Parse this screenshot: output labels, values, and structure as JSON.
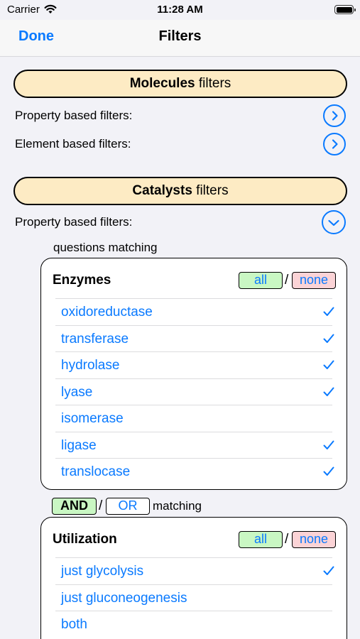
{
  "status": {
    "carrier": "Carrier",
    "time": "11:28 AM"
  },
  "nav": {
    "done_label": "Done",
    "title": "Filters"
  },
  "molecules": {
    "header_bold": "Molecules",
    "header_rest": " filters",
    "property_label": "Property based filters:",
    "element_label": "Element based filters:"
  },
  "catalysts": {
    "header_bold": "Catalysts",
    "header_rest": " filters",
    "property_label": "Property based filters:",
    "questions_matching": "questions matching",
    "enzymes": {
      "title": "Enzymes",
      "all_label": "all",
      "slash": "/",
      "none_label": "none",
      "options": [
        {
          "label": "oxidoreductase",
          "checked": true
        },
        {
          "label": "transferase",
          "checked": true
        },
        {
          "label": "hydrolase",
          "checked": true
        },
        {
          "label": "lyase",
          "checked": true
        },
        {
          "label": "isomerase",
          "checked": false
        },
        {
          "label": "ligase",
          "checked": true
        },
        {
          "label": "translocase",
          "checked": true
        }
      ]
    },
    "combinator": {
      "and_label": "AND",
      "slash": "/",
      "or_label": "OR",
      "matching": "matching"
    },
    "utilization": {
      "title": "Utilization",
      "all_label": "all",
      "slash": "/",
      "none_label": "none",
      "options": [
        {
          "label": "just glycolysis",
          "checked": true
        },
        {
          "label": "just gluconeogenesis",
          "checked": false
        },
        {
          "label": "both",
          "checked": false
        }
      ]
    }
  },
  "colors": {
    "accent": "#0a7aff",
    "header_bg": "#fdebc4",
    "all_bg": "#c9f7c3",
    "none_bg": "#fbd3d6"
  }
}
